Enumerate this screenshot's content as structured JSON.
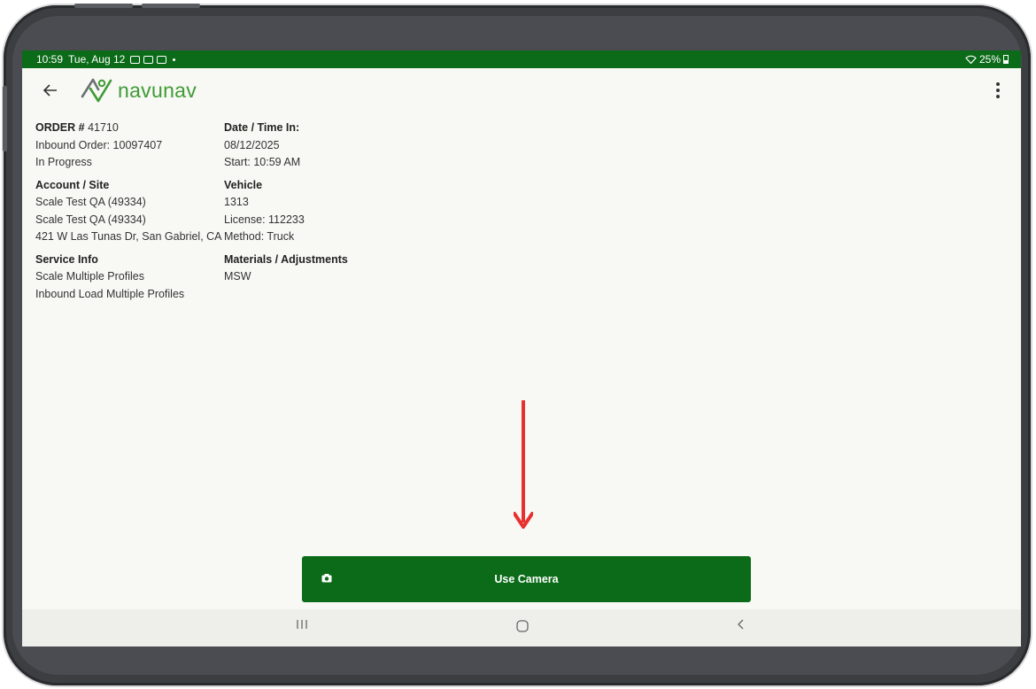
{
  "status_bar": {
    "time": "10:59",
    "date": "Tue, Aug 12",
    "battery": "25%"
  },
  "app_bar": {
    "logo_text": "navunav"
  },
  "order": {
    "order_label": "ORDER #",
    "order_number": "41710",
    "inbound_order": "Inbound Order: 10097407",
    "status": "In Progress"
  },
  "account_site": {
    "title": "Account / Site",
    "account": "Scale Test QA (49334)",
    "site": "Scale Test QA (49334)",
    "address": "421 W Las Tunas Dr, San Gabriel, CA"
  },
  "service_info": {
    "title": "Service Info",
    "line1": "Scale Multiple Profiles",
    "line2": "Inbound Load Multiple Profiles"
  },
  "date_time": {
    "title": "Date / Time In:",
    "date": "08/12/2025",
    "start": "Start: 10:59 AM"
  },
  "vehicle": {
    "title": "Vehicle",
    "number": "1313",
    "license": "License: 112233",
    "method": "Method: Truck"
  },
  "materials": {
    "title": "Materials / Adjustments",
    "value": "MSW"
  },
  "camera_button": {
    "label": "Use Camera"
  },
  "colors": {
    "brand_green": "#0b6b18",
    "logo_green": "#3f9b35",
    "annotation_red": "#e8302f"
  }
}
